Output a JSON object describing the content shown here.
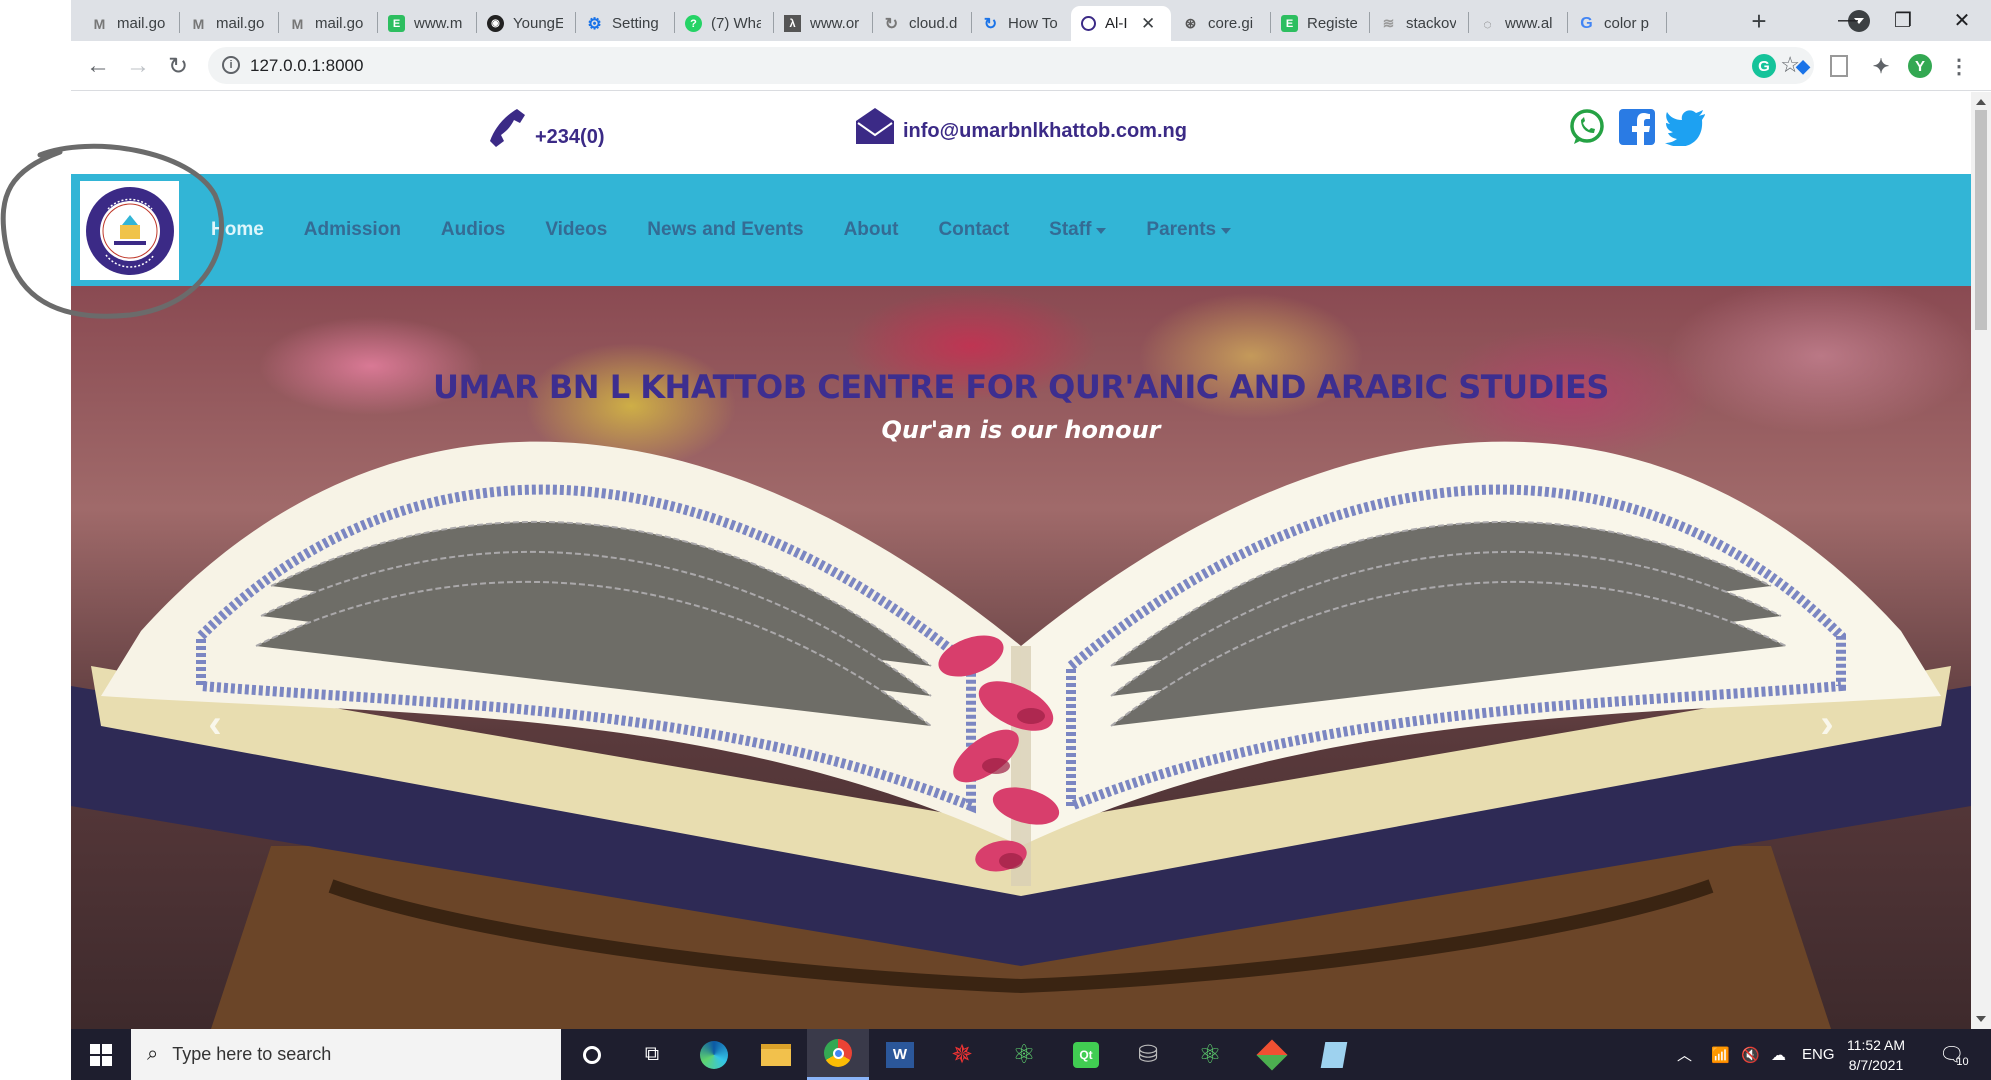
{
  "browser": {
    "tabs": [
      {
        "label": "mail.go",
        "icon": "gmail-icon"
      },
      {
        "label": "mail.go",
        "icon": "gmail-icon"
      },
      {
        "label": "mail.go",
        "icon": "gmail-icon"
      },
      {
        "label": "www.m",
        "icon": "evernote-icon"
      },
      {
        "label": "YoungE",
        "icon": "github-icon"
      },
      {
        "label": "Setting",
        "icon": "gear-icon"
      },
      {
        "label": "(7) Wha",
        "icon": "whatsapp-icon"
      },
      {
        "label": "www.or",
        "icon": "doc-icon"
      },
      {
        "label": "cloud.d",
        "icon": "cloud-icon"
      },
      {
        "label": "How To",
        "icon": "howto-icon"
      },
      {
        "label": "Al-I",
        "icon": "site-logo-icon",
        "active": true
      },
      {
        "label": "core.gi",
        "icon": "core-icon"
      },
      {
        "label": "Registe",
        "icon": "evernote-icon"
      },
      {
        "label": "stackov",
        "icon": "stackoverflow-icon"
      },
      {
        "label": "www.al",
        "icon": "chat-icon"
      },
      {
        "label": "color p",
        "icon": "google-icon"
      }
    ],
    "url": "127.0.0.1:8000",
    "profile_initial": "Y",
    "accent": "#1a73e8"
  },
  "site": {
    "phone": "+234(0)",
    "email": "info@umarbnlkhattob.com.ng",
    "nav": [
      {
        "label": "Home",
        "active": true
      },
      {
        "label": "Admission"
      },
      {
        "label": "Audios"
      },
      {
        "label": "Videos"
      },
      {
        "label": "News and Events"
      },
      {
        "label": "About"
      },
      {
        "label": "Contact"
      },
      {
        "label": "Staff",
        "dropdown": true
      },
      {
        "label": "Parents",
        "dropdown": true
      }
    ],
    "hero_title": "UMAR BN L KHATTOB CENTRE FOR QUR'ANIC AND ARABIC STUDIES",
    "hero_subtitle": "Qur'an is our honour",
    "colors": {
      "navbar": "#32b5d6",
      "brand": "#3b2a86",
      "nav_link": "#346b94"
    }
  },
  "taskbar": {
    "search_placeholder": "Type here to search",
    "language": "ENG",
    "time": "11:52 AM",
    "date": "8/7/2021",
    "notification_count": "10"
  }
}
